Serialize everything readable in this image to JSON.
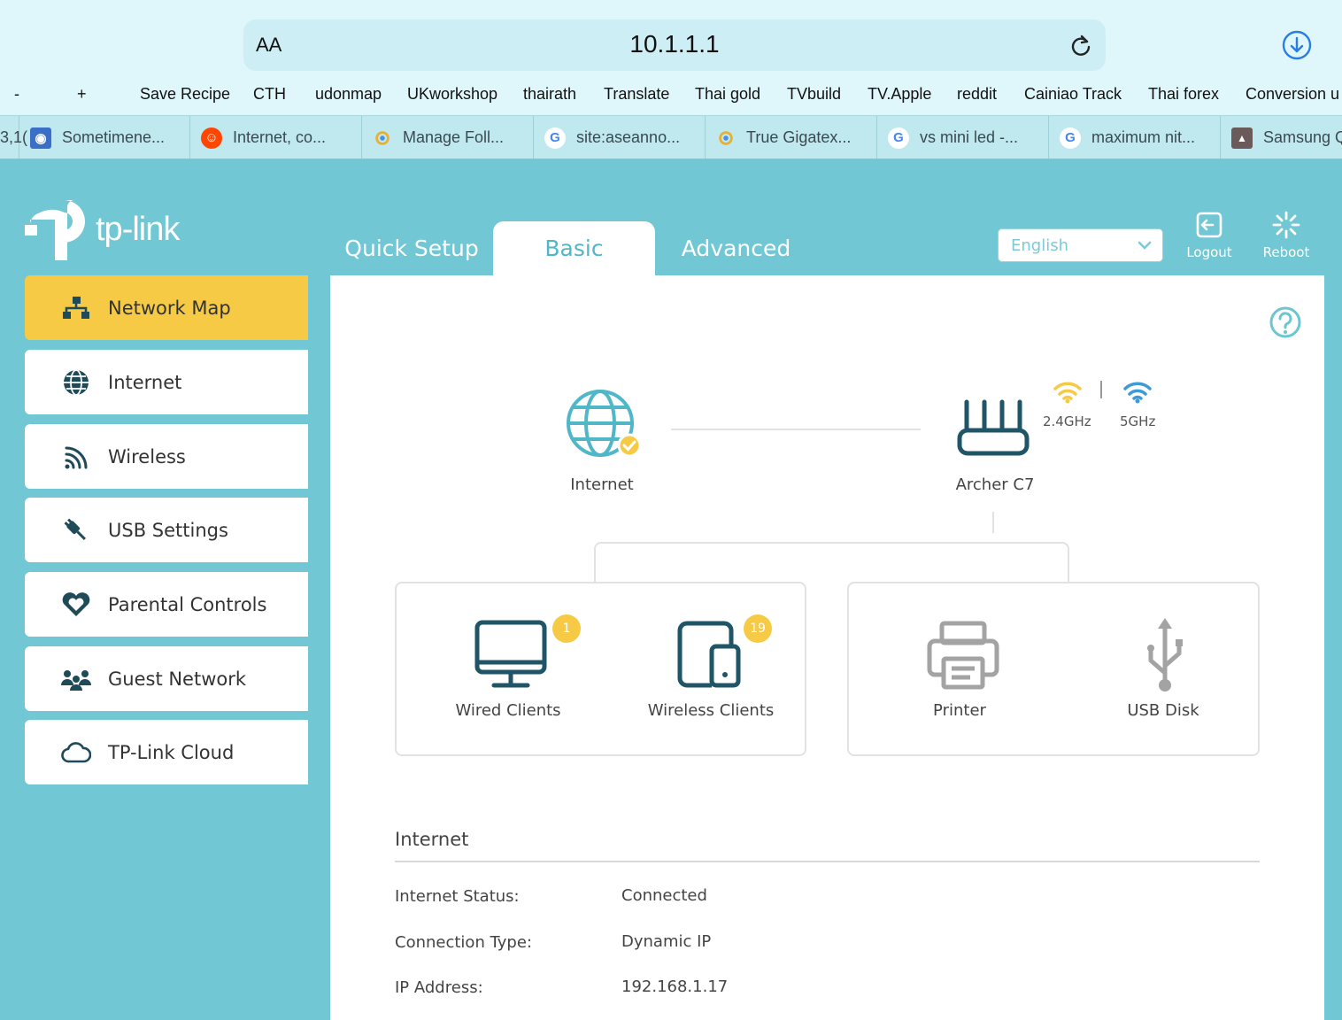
{
  "browser": {
    "text_size_label": "AA",
    "url": "10.1.1.1",
    "bookmarks": [
      "-",
      "+",
      "Save Recipe",
      "CTH",
      "udonmap",
      "UKworkshop",
      "thairath",
      "Translate",
      "Thai gold",
      "TVbuild",
      "TV.Apple",
      "reddit",
      "Cainiao Track",
      "Thai forex",
      "Conversion u"
    ],
    "tabs": [
      {
        "prefix": "3,1(",
        "title": ""
      },
      {
        "title": "Sometimene...",
        "icon": "blue-square-icon"
      },
      {
        "title": "Internet, co...",
        "icon": "reddit-icon"
      },
      {
        "title": "Manage Foll...",
        "icon": "chrome-icon"
      },
      {
        "title": "site:aseanno...",
        "icon": "google-icon"
      },
      {
        "title": "True Gigatex...",
        "icon": "chrome-icon"
      },
      {
        "title": "vs mini led -...",
        "icon": "google-icon"
      },
      {
        "title": "maximum nit...",
        "icon": "google-icon"
      },
      {
        "title": "Samsung Q",
        "icon": "image-icon"
      }
    ]
  },
  "router": {
    "logo_text": "tp-link",
    "main_tabs": [
      "Quick Setup",
      "Basic",
      "Advanced"
    ],
    "active_tab": "Basic",
    "language": "English",
    "logout_label": "Logout",
    "reboot_label": "Reboot",
    "sidebar": [
      {
        "label": "Network Map",
        "icon": "network-map-icon",
        "active": true
      },
      {
        "label": "Internet",
        "icon": "globe-icon",
        "active": false
      },
      {
        "label": "Wireless",
        "icon": "wifi-signal-icon",
        "active": false
      },
      {
        "label": "USB Settings",
        "icon": "usb-plug-icon",
        "active": false
      },
      {
        "label": "Parental Controls",
        "icon": "heart-icon",
        "active": false
      },
      {
        "label": "Guest Network",
        "icon": "guest-users-icon",
        "active": false
      },
      {
        "label": "TP-Link Cloud",
        "icon": "cloud-icon",
        "active": false
      }
    ],
    "network_map": {
      "internet_label": "Internet",
      "router_label": "Archer C7",
      "band_24": "2.4GHz",
      "band_5": "5GHz",
      "wired_clients_label": "Wired Clients",
      "wired_clients_count": "1",
      "wireless_clients_label": "Wireless Clients",
      "wireless_clients_count": "19",
      "printer_label": "Printer",
      "usb_disk_label": "USB Disk"
    },
    "internet_section": {
      "title": "Internet",
      "rows": [
        {
          "key": "Internet Status:",
          "value": "Connected"
        },
        {
          "key": "Connection Type:",
          "value": "Dynamic IP"
        },
        {
          "key": "IP Address:",
          "value": "192.168.1.17"
        }
      ]
    },
    "colors": {
      "background": "#71c7d3",
      "accent": "#4fb7c8",
      "active_yellow": "#f6ca45",
      "icon_dark": "#1f4a58"
    }
  }
}
